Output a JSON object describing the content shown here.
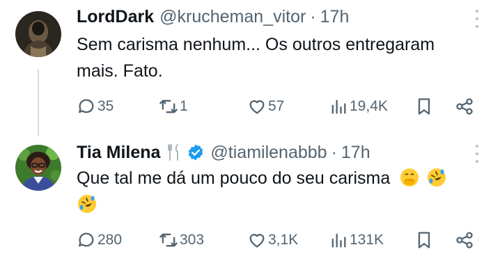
{
  "tweets": [
    {
      "name": "LordDark",
      "handle": "@krucheman_vitor",
      "separator": "·",
      "time": "17h",
      "text_line1": "Sem carisma nenhum... Os outros entregaram",
      "text_line2": "mais. Fato.",
      "replies": "35",
      "retweets": "1",
      "likes": "57",
      "views": "19,4K"
    },
    {
      "name": "Tia Milena",
      "handle": "@tiamilenabbb",
      "separator": "·",
      "time": "17h",
      "text_line1": "Que tal me dá um pouco do seu carisma",
      "verified_color": "#1d9bf0",
      "emojis": [
        "face-with-hand-over-mouth",
        "rolling-on-floor-laughing",
        "rolling-on-floor-laughing"
      ],
      "replies": "280",
      "retweets": "303",
      "likes": "3,1K",
      "views": "131K"
    }
  ]
}
